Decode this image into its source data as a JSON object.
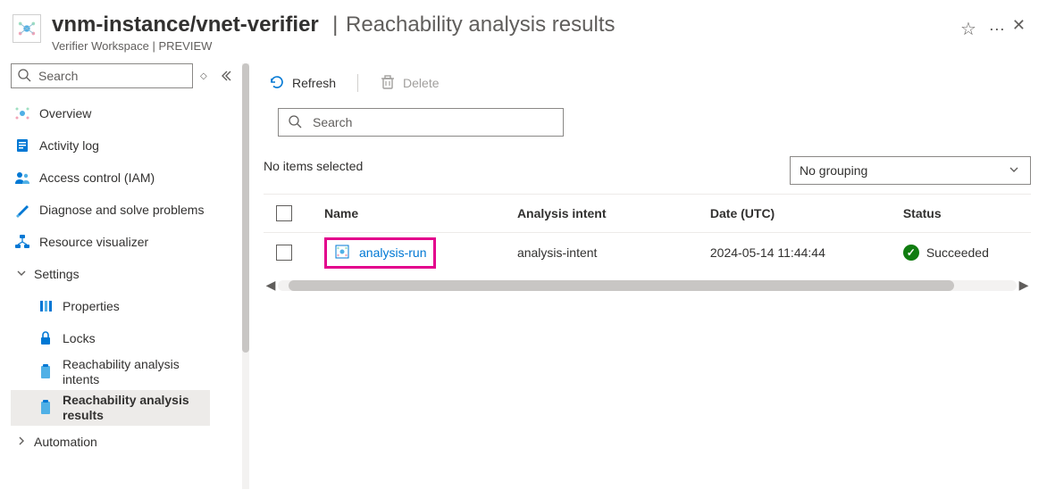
{
  "header": {
    "resource_path": "vnm-instance/vnet-verifier",
    "page_title": "Reachability analysis results",
    "subtitle": "Verifier Workspace | PREVIEW"
  },
  "sidebar": {
    "search_placeholder": "Search",
    "items": [
      {
        "label": "Overview"
      },
      {
        "label": "Activity log"
      },
      {
        "label": "Access control (IAM)"
      },
      {
        "label": "Diagnose and solve problems"
      },
      {
        "label": "Resource visualizer"
      }
    ],
    "section_settings": "Settings",
    "settings_items": [
      {
        "label": "Properties"
      },
      {
        "label": "Locks"
      },
      {
        "label": "Reachability analysis intents"
      },
      {
        "label": "Reachability analysis results"
      }
    ],
    "section_automation": "Automation"
  },
  "toolbar": {
    "refresh": "Refresh",
    "delete": "Delete"
  },
  "content": {
    "search_placeholder": "Search",
    "selection_text": "No items selected",
    "grouping_value": "No grouping"
  },
  "table": {
    "columns": {
      "name": "Name",
      "intent": "Analysis intent",
      "date": "Date (UTC)",
      "status": "Status"
    },
    "row": {
      "name": "analysis-run",
      "intent": "analysis-intent",
      "date": "2024-05-14 11:44:44",
      "status": "Succeeded"
    }
  }
}
